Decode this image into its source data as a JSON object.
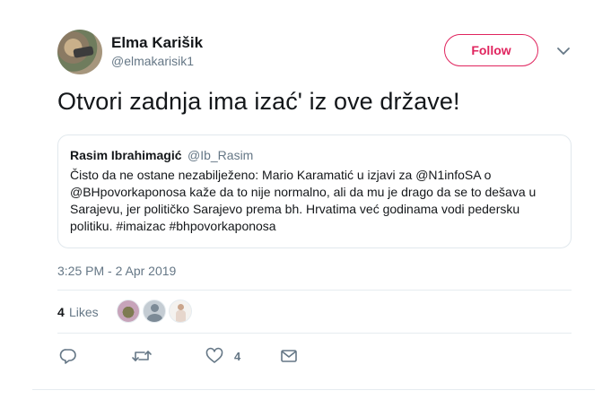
{
  "author": {
    "name": "Elma Karišik",
    "handle": "@elmakarisik1",
    "follow_label": "Follow"
  },
  "tweet": {
    "text": "Otvori zadnja ima izać' iz ove države!",
    "timestamp": "3:25 PM - 2 Apr 2019"
  },
  "quoted_tweet": {
    "name": "Rasim Ibrahimagić",
    "handle": "@Ib_Rasim",
    "lines": [
      "Čisto da ne ostane nezabilježeno: Mario Karamatić u izjavi za @N1infoSA o",
      "@BHpovorkaponosa kaže da to nije normalno, ali da mu je drago da se to dešava u",
      "Sarajevu, jer političko Sarajevo prema bh. Hrvatima već godinama vodi pedersku",
      "politiku. #imaizac #bhpovorkaponosa"
    ]
  },
  "stats": {
    "likes_count": "4",
    "likes_label": "Likes"
  },
  "actions": {
    "like_count": "4"
  },
  "icons": {
    "caret": "chevron-down-icon",
    "reply": "reply-icon",
    "retweet": "retweet-icon",
    "like": "heart-icon",
    "dm": "envelope-icon"
  },
  "colors": {
    "accent": "#e0245e",
    "secondary_text": "#657786",
    "border": "#e1e8ed"
  }
}
